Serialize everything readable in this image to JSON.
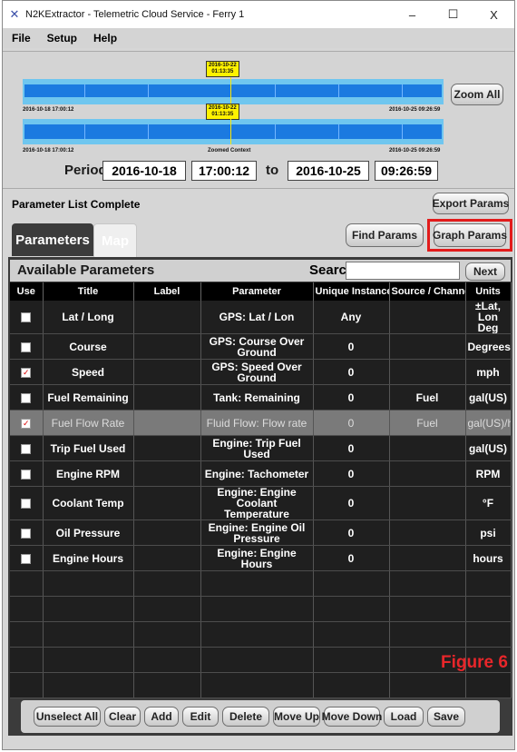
{
  "window": {
    "title": "N2KExtractor - Telemetric Cloud Service - Ferry 1",
    "minimize": "–",
    "maximize": "☐",
    "close": "X"
  },
  "menu": [
    "File",
    "Setup",
    "Help"
  ],
  "timeline": {
    "top_flag_date": "2016-10-22",
    "top_flag_time": "01:13:35",
    "mid_flag_date": "2016-10-22",
    "mid_flag_time": "01:13:35",
    "top_start": "2016-10-18 17:00:12",
    "top_end": "2016-10-25 09:26:59",
    "bottom_start": "2016-10-18 17:00:12",
    "bottom_center": "Zoomed Context",
    "bottom_end": "2016-10-25 09:26:59",
    "zoom_all": "Zoom All"
  },
  "period": {
    "label": "Period",
    "start_date": "2016-10-18",
    "start_time": "17:00:12",
    "to": "to",
    "end_date": "2016-10-25",
    "end_time": "09:26:59"
  },
  "status": "Parameter List Complete",
  "buttons": {
    "export": "Export Params",
    "find": "Find Params",
    "graph": "Graph Params",
    "next": "Next"
  },
  "tabs": {
    "parameters": "Parameters",
    "map": "Map"
  },
  "available": {
    "title": "Available Parameters",
    "search_label": "Search",
    "search_value": ""
  },
  "columns": [
    "Use",
    "Title",
    "Label",
    "Parameter",
    "Unique Instance",
    "Source / Channel",
    "Units"
  ],
  "rows": [
    {
      "checked": false,
      "title": "Lat / Long",
      "label": "",
      "parameter": "GPS: Lat / Lon",
      "instance": "Any",
      "source": "",
      "units": "±Lat, Lon Deg"
    },
    {
      "checked": false,
      "title": "Course",
      "label": "",
      "parameter": "GPS: Course Over Ground",
      "instance": "0",
      "source": "",
      "units": "Degrees"
    },
    {
      "checked": true,
      "title": "Speed",
      "label": "",
      "parameter": "GPS: Speed Over Ground",
      "instance": "0",
      "source": "",
      "units": "mph"
    },
    {
      "checked": false,
      "title": "Fuel Remaining",
      "label": "",
      "parameter": "Tank: Remaining",
      "instance": "0",
      "source": "Fuel",
      "units": "gal(US)"
    },
    {
      "checked": true,
      "title": "Fuel Flow Rate",
      "label": "",
      "parameter": "Fluid Flow: Flow rate",
      "instance": "0",
      "source": "Fuel",
      "units": "gal(US)/h",
      "selected": true
    },
    {
      "checked": false,
      "title": "Trip Fuel Used",
      "label": "",
      "parameter": "Engine: Trip Fuel Used",
      "instance": "0",
      "source": "",
      "units": "gal(US)"
    },
    {
      "checked": false,
      "title": "Engine RPM",
      "label": "",
      "parameter": "Engine: Tachometer",
      "instance": "0",
      "source": "",
      "units": "RPM"
    },
    {
      "checked": false,
      "title": "Coolant Temp",
      "label": "",
      "parameter": "Engine: Engine Coolant Temperature",
      "instance": "0",
      "source": "",
      "units": "°F"
    },
    {
      "checked": false,
      "title": "Oil Pressure",
      "label": "",
      "parameter": "Engine: Engine Oil Pressure",
      "instance": "0",
      "source": "",
      "units": "psi"
    },
    {
      "checked": false,
      "title": "Engine Hours",
      "label": "",
      "parameter": "Engine: Engine Hours",
      "instance": "0",
      "source": "",
      "units": "hours"
    }
  ],
  "empty_rows": 5,
  "figure_label": "Figure 6",
  "bottom_buttons": [
    "Unselect All",
    "Clear",
    "Add",
    "Edit",
    "Delete",
    "Move Up",
    "Move Down",
    "Load",
    "Save"
  ],
  "colors": {
    "highlight": "#e21b1b",
    "track": "#1b7ae0",
    "flag": "#fff200"
  }
}
